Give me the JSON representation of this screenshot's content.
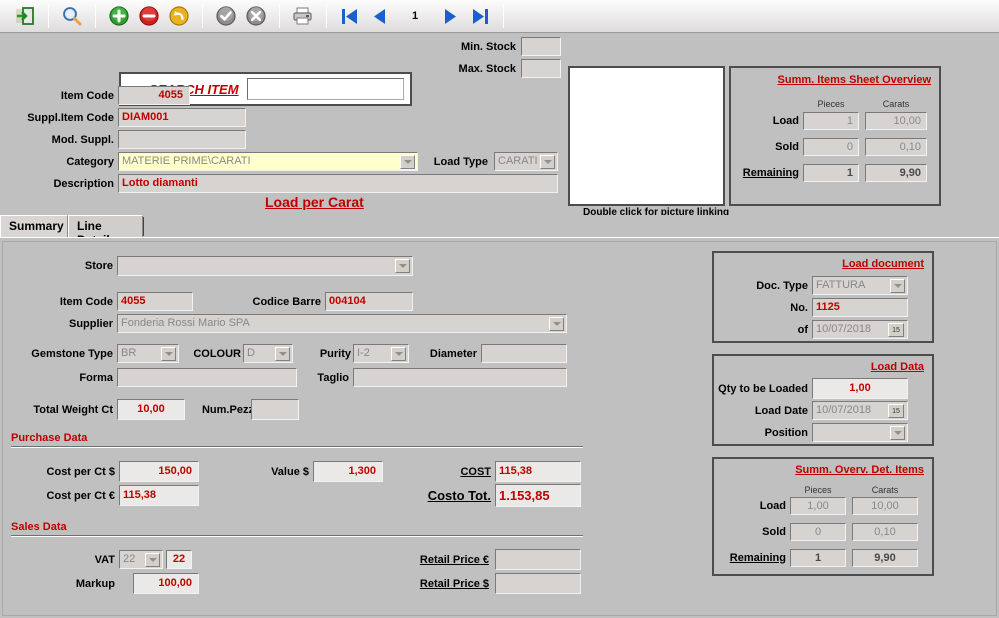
{
  "toolbar": {
    "icons": [
      {
        "name": "exit-icon",
        "glyph": "exit"
      },
      {
        "name": "search-icon",
        "glyph": "search"
      },
      {
        "name": "add-icon",
        "glyph": "add"
      },
      {
        "name": "delete-icon",
        "glyph": "delete"
      },
      {
        "name": "undo-icon",
        "glyph": "undo"
      },
      {
        "name": "confirm-icon",
        "glyph": "confirm"
      },
      {
        "name": "cancel-icon",
        "glyph": "cancel"
      },
      {
        "name": "print-icon",
        "glyph": "print"
      },
      {
        "name": "first-record-icon",
        "glyph": "first"
      },
      {
        "name": "prev-record-icon",
        "glyph": "prev"
      },
      {
        "name": "next-record-icon",
        "glyph": "next"
      },
      {
        "name": "last-record-icon",
        "glyph": "last"
      }
    ],
    "page_number": "1"
  },
  "search": {
    "label": "SEARCH ITEM",
    "value": "",
    "placeholder": ""
  },
  "header": {
    "item_code_label": "Item Code",
    "item_code_value": "4055",
    "suppl_item_code_label": "Suppl.Item Code",
    "suppl_item_code_value": "DIAM001",
    "mod_suppl_label": "Mod. Suppl.",
    "mod_suppl_value": "",
    "category_label": "Category",
    "category_value": "MATERIE PRIME\\CARATI",
    "description_label": "Description",
    "description_value": "Lotto diamanti",
    "min_stock_label": "Min. Stock",
    "min_stock_value": "",
    "max_stock_label": "Max. Stock",
    "max_stock_value": "",
    "load_type_label": "Load Type",
    "load_type_value": "CARATI",
    "picture_caption": "Double click for picture linking"
  },
  "summary_overview": {
    "title": "Summ. Items Sheet Overview",
    "col_pieces": "Pieces",
    "col_carats": "Carats",
    "rows": [
      {
        "label": "Load",
        "pieces": "1",
        "carats": "10,00"
      },
      {
        "label": "Sold",
        "pieces": "0",
        "carats": "0,10"
      },
      {
        "label": "Remaining",
        "pieces": "1",
        "carats": "9,90"
      }
    ]
  },
  "page_heading": "Load per Carat",
  "tabs": [
    {
      "label": "Summary",
      "active": false
    },
    {
      "label": "Line Detail",
      "active": true
    }
  ],
  "detail": {
    "store_label": "Store",
    "store_value": "",
    "item_code_label": "Item Code",
    "item_code_value": "4055",
    "codice_barre_label": "Codice Barre",
    "codice_barre_value": "004104",
    "supplier_label": "Supplier",
    "supplier_value": "Fonderia Rossi Mario SPA",
    "gemstone_type_label": "Gemstone Type",
    "gemstone_type_value": "BR",
    "colour_label": "COLOUR",
    "colour_value": "D",
    "purity_label": "Purity",
    "purity_value": "I-2",
    "diameter_label": "Diameter",
    "diameter_value": "",
    "forma_label": "Forma",
    "forma_value": "",
    "taglio_label": "Taglio",
    "taglio_value": "",
    "total_weight_label": "Total Weight Ct",
    "total_weight_value": "10,00",
    "num_pezzi_label": "Num.Pezzi",
    "num_pezzi_value": ""
  },
  "purchase_data": {
    "title": "Purchase Data",
    "cost_per_ct_usd_label": "Cost per Ct $",
    "cost_per_ct_usd_value": "150,00",
    "cost_per_ct_eur_label": "Cost per Ct €",
    "cost_per_ct_eur_value": "115,38",
    "value_usd_label": "Value $",
    "value_usd_value": "1,300",
    "cost_label": "COST",
    "cost_value": "115,38",
    "costo_tot_label": "Costo Tot.",
    "costo_tot_value": "1.153,85"
  },
  "sales_data": {
    "title": "Sales Data",
    "vat_label": "VAT",
    "vat_select_value": "22",
    "vat_value": "22",
    "markup_label": "Markup",
    "markup_value": "100,00",
    "retail_price_eur_label": "Retail Price €",
    "retail_price_eur_value": "",
    "retail_price_usd_label": "Retail Price $",
    "retail_price_usd_value": ""
  },
  "load_document": {
    "title": "Load document",
    "doc_type_label": "Doc. Type",
    "doc_type_value": "FATTURA",
    "no_label": "No.",
    "no_value": "1125",
    "of_label": "of",
    "of_value": "10/07/2018"
  },
  "load_data": {
    "title": "Load Data",
    "qty_label": "Qty to be Loaded",
    "qty_value": "1,00",
    "load_date_label": "Load Date",
    "load_date_value": "10/07/2018",
    "position_label": "Position",
    "position_value": ""
  },
  "summary_det_items": {
    "title": "Summ. Overv. Det. Items",
    "col_pieces": "Pieces",
    "col_carats": "Carats",
    "rows": [
      {
        "label": "Load",
        "pieces": "1,00",
        "carats": "10,00"
      },
      {
        "label": "Sold",
        "pieces": "0",
        "carats": "0,10"
      },
      {
        "label": "Remaining",
        "pieces": "1",
        "carats": "9,90"
      }
    ]
  },
  "colors": {
    "accent_red": "#c00000",
    "background": "#c0c0c0",
    "field_bg": "#d6d3d1",
    "category_bg": "#ffffcc",
    "nav_blue": "#1a5fcc"
  }
}
